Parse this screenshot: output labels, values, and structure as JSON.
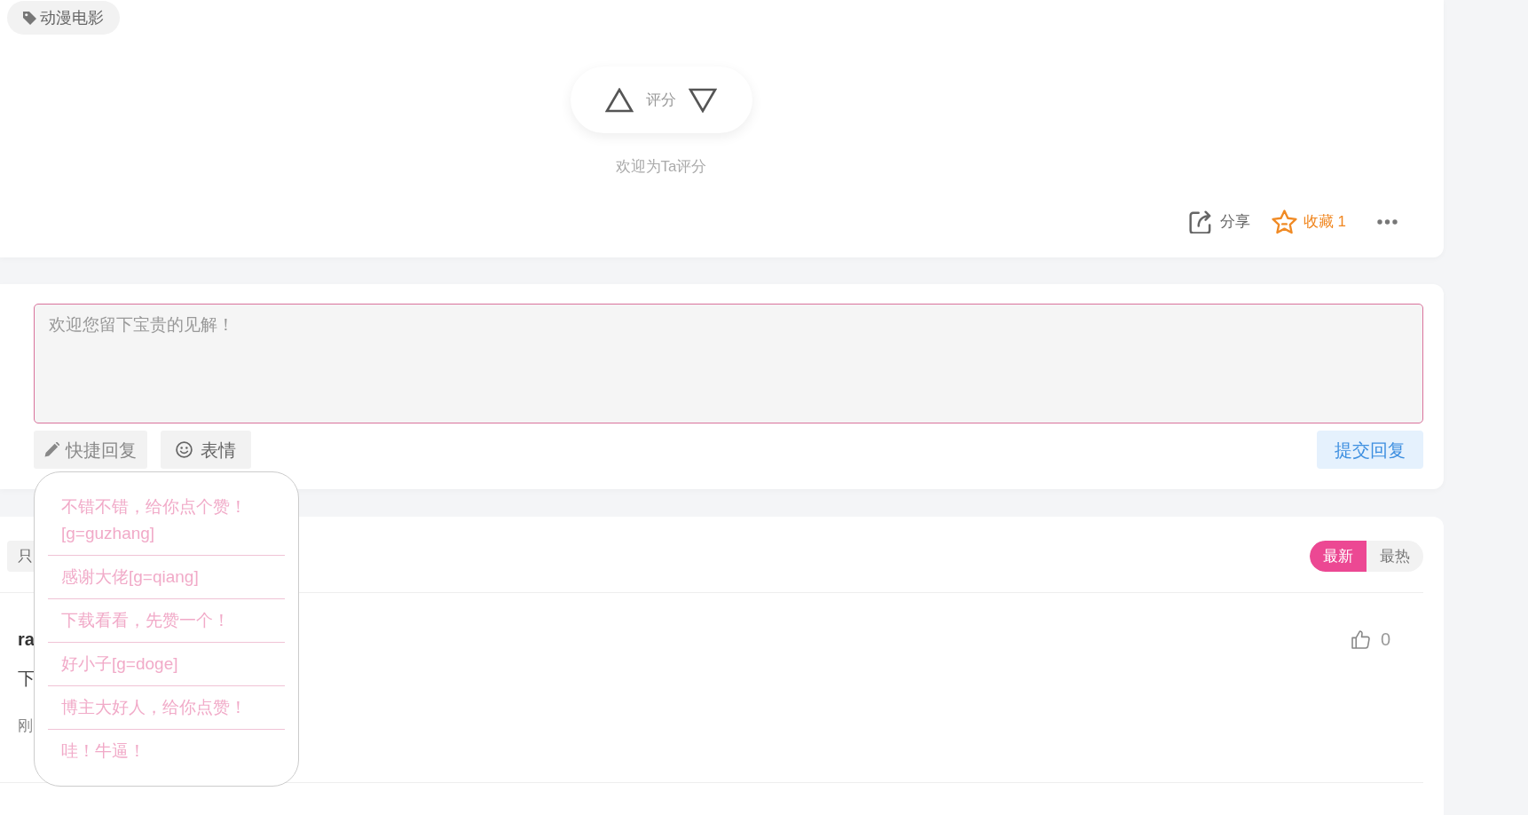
{
  "tag": {
    "label": "动漫电影"
  },
  "rating": {
    "label": "评分",
    "hint": "欢迎为Ta评分"
  },
  "actions": [
    {
      "kind": "share",
      "label": "分享"
    },
    {
      "kind": "favorite",
      "label": "收藏 1"
    },
    {
      "kind": "more"
    }
  ],
  "comment_box": {
    "placeholder": "欢迎您留下宝贵的见解！",
    "tools": [
      {
        "kind": "quick_reply",
        "label": "快捷回复",
        "expanded": true,
        "options": [
          "不错不错，给你点个赞！[g=guzhang]",
          "感谢大佬[g=qiang]",
          "下载看看，先赞一个！",
          "好小子[g=doge]",
          "博主大好人，给你点赞！",
          "哇！牛逼！"
        ]
      },
      {
        "kind": "emoji",
        "label": "表情"
      }
    ],
    "submit": "提交回复"
  },
  "comments": {
    "filter_button": "只",
    "sort_tabs": [
      {
        "label": "最新",
        "selected": true
      },
      {
        "label": "最热",
        "selected": false
      }
    ],
    "items": [
      {
        "author": "ra",
        "text": "下",
        "time": "刚",
        "likes": "0"
      }
    ]
  }
}
